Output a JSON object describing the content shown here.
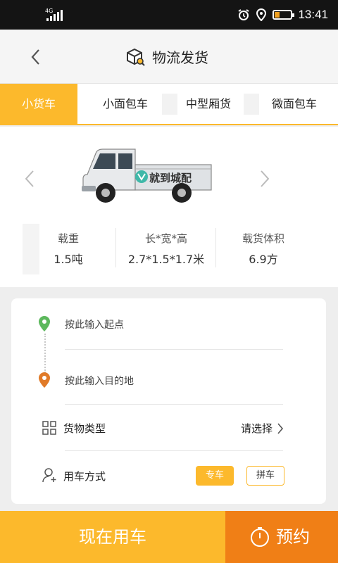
{
  "status_bar": {
    "network": "4G",
    "time": "13:41"
  },
  "header": {
    "title": "物流发货"
  },
  "tabs": [
    {
      "label": "小货车",
      "active": true
    },
    {
      "label": "小面包车",
      "active": false
    },
    {
      "label": "中型厢货",
      "active": false
    },
    {
      "label": "微面包车",
      "active": false
    }
  ],
  "vehicle": {
    "brand_text": "就到城配",
    "specs": [
      {
        "label": "载重",
        "value": "1.5吨"
      },
      {
        "label": "长*宽*高",
        "value": "2.7*1.5*1.7米"
      },
      {
        "label": "载货体积",
        "value": "6.9方"
      }
    ]
  },
  "form": {
    "start_placeholder": "按此输入起点",
    "dest_placeholder": "按此输入目的地",
    "cargo_type_label": "货物类型",
    "cargo_type_value": "请选择",
    "usage_label": "用车方式",
    "usage_options": [
      {
        "label": "专车",
        "selected": true
      },
      {
        "label": "拼车",
        "selected": false
      }
    ]
  },
  "actions": {
    "now_label": "现在用车",
    "book_label": "预约"
  },
  "colors": {
    "accent": "#fcb92c",
    "book": "#f07f16",
    "start_pin": "#5cb85c",
    "dest_pin": "#e07a28"
  }
}
